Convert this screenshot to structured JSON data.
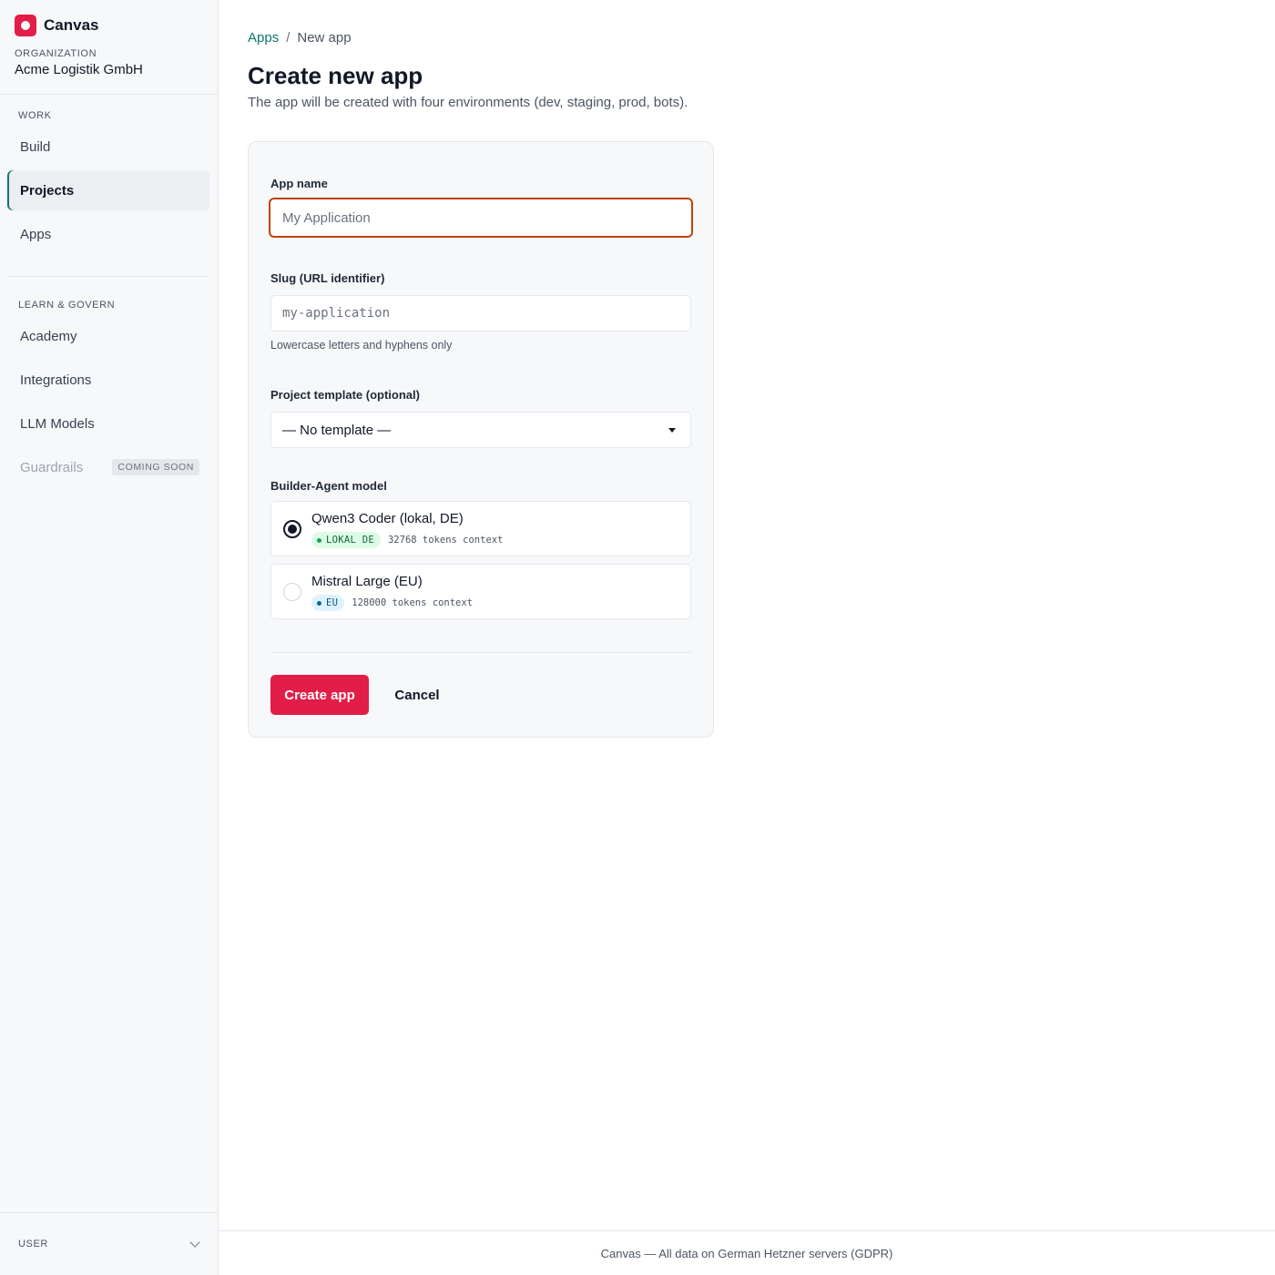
{
  "brand": {
    "name": "Canvas",
    "logo_icon": "canvas-logo-icon",
    "color": "#e11d48"
  },
  "organization": {
    "label": "ORGANIZATION",
    "name": "Acme Logistik GmbH"
  },
  "sidebar": {
    "sections": [
      {
        "label": "WORK",
        "items": [
          {
            "label": "Build",
            "state": "normal"
          },
          {
            "label": "Projects",
            "state": "active"
          },
          {
            "label": "Apps",
            "state": "normal"
          }
        ]
      },
      {
        "label": "LEARN & GOVERN",
        "items": [
          {
            "label": "Academy",
            "state": "normal"
          },
          {
            "label": "Integrations",
            "state": "normal"
          },
          {
            "label": "LLM Models",
            "state": "normal"
          },
          {
            "label": "Guardrails",
            "state": "disabled",
            "badge": "COMING SOON"
          }
        ]
      }
    ],
    "user": {
      "label": "USER",
      "icon": "chevron-down-icon"
    }
  },
  "breadcrumb": {
    "parent": "Apps",
    "separator": "/",
    "current": "New app"
  },
  "page": {
    "title": "Create new app",
    "subtitle": "The app will be created with four environments (dev, staging, prod, bots)."
  },
  "form": {
    "app_name": {
      "label": "App name",
      "value": "",
      "placeholder": "My Application"
    },
    "slug": {
      "label": "Slug (URL identifier)",
      "value": "",
      "placeholder": "my-application",
      "hint": "Lowercase letters and hyphens only"
    },
    "template": {
      "label": "Project template (optional)",
      "selected": "— No template —",
      "icon": "caret-down-icon"
    },
    "model": {
      "label": "Builder-Agent model",
      "options": [
        {
          "name": "Qwen3 Coder (lokal, DE)",
          "badge": "LOKAL DE",
          "badge_color": "#16a34a",
          "context": "32768 tokens context",
          "checked": true
        },
        {
          "name": "Mistral Large (EU)",
          "badge": "EU",
          "badge_color": "#0369a1",
          "context": "128000 tokens context",
          "checked": false
        }
      ]
    },
    "submit_label": "Create app",
    "cancel_label": "Cancel"
  },
  "footer": {
    "text": "Canvas — All data on German Hetzner servers (GDPR)"
  },
  "colors": {
    "accent": "#e11d48",
    "link": "#0f766e",
    "focus_ring": "#c2410c"
  }
}
